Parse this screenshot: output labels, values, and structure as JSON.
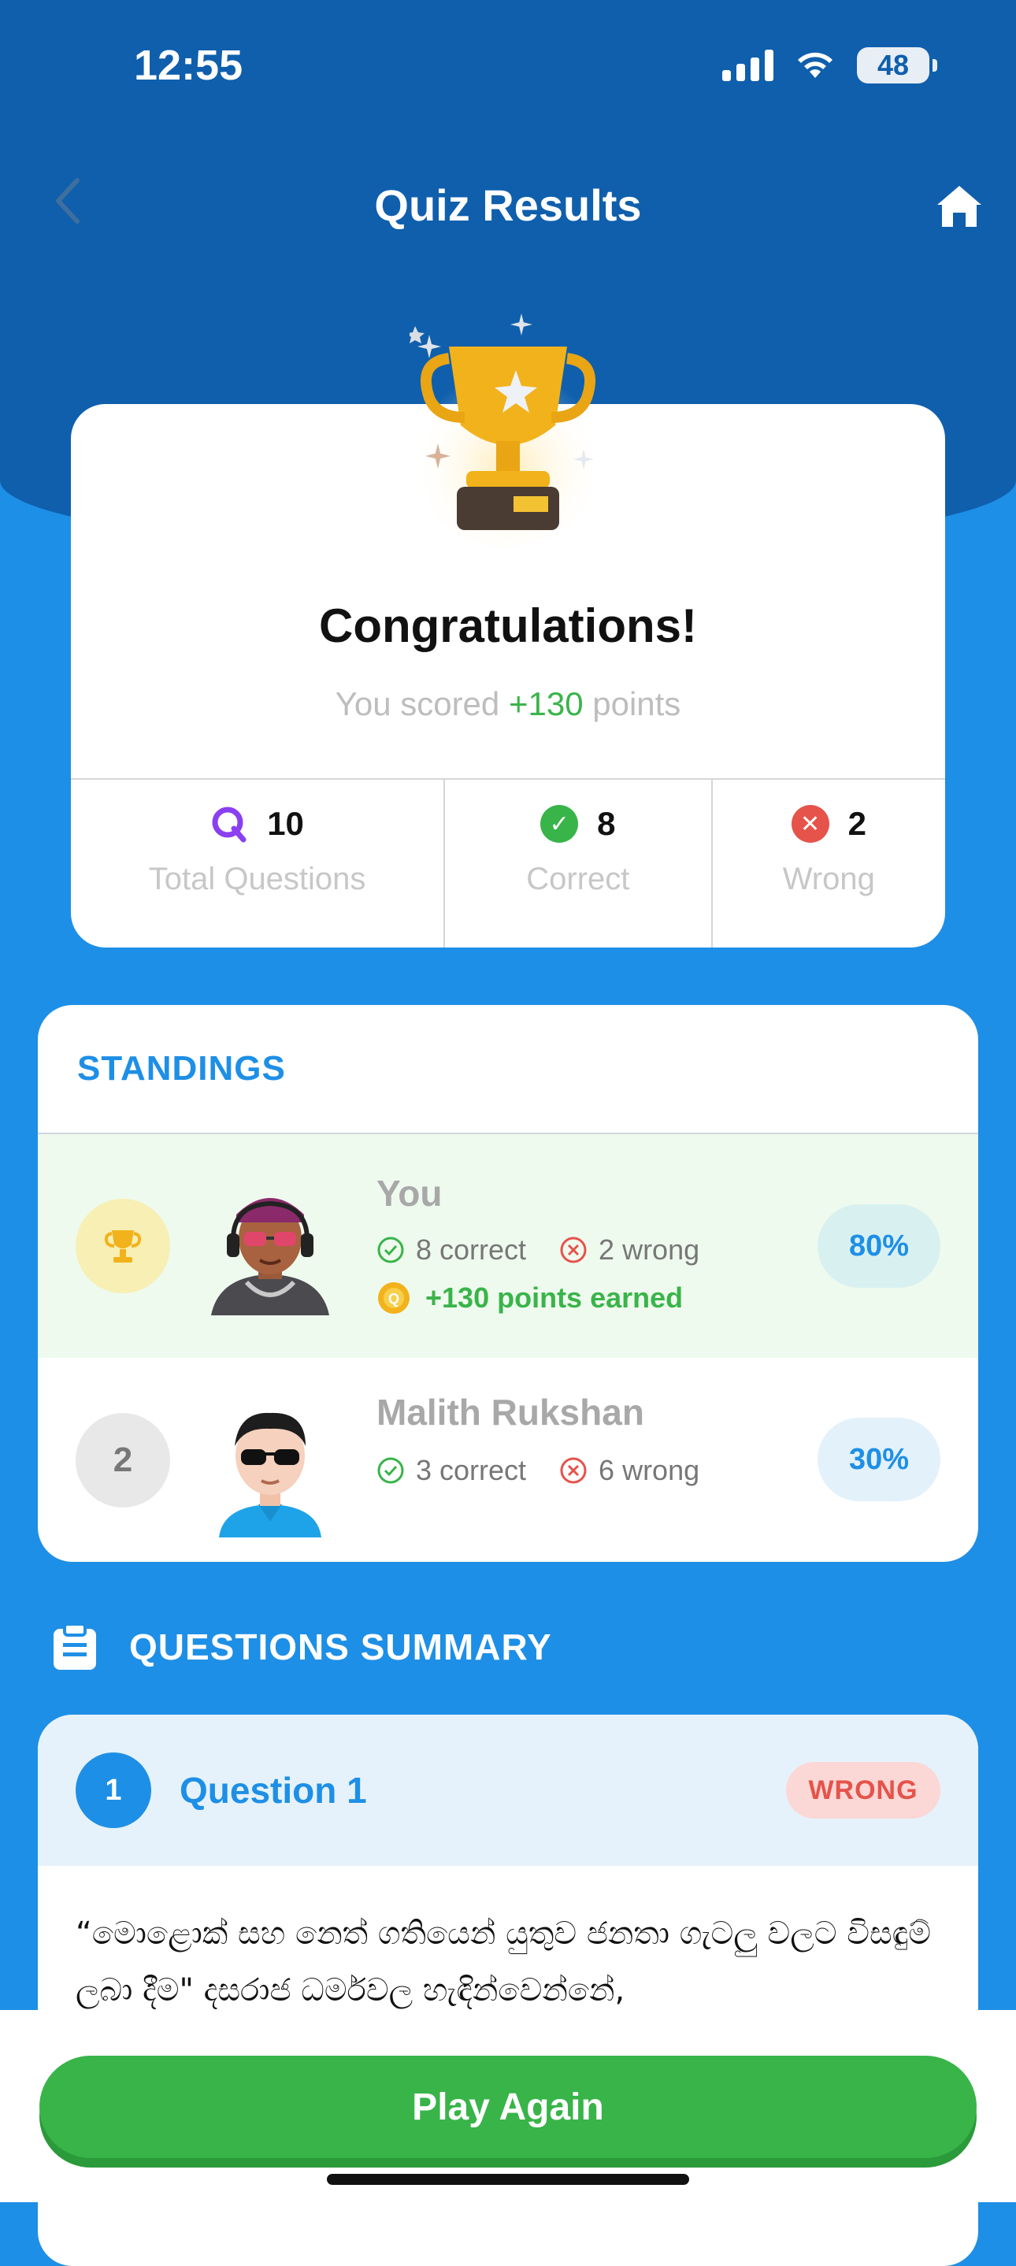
{
  "status": {
    "time": "12:55",
    "battery": "48"
  },
  "nav": {
    "title": "Quiz Results",
    "back_icon": "chevron-left-icon",
    "home_icon": "home-icon"
  },
  "hero": {
    "title": "Congratulations!",
    "score_prefix": "You scored ",
    "score_points": "+130",
    "score_suffix": " points",
    "stats": [
      {
        "value": "10",
        "label": "Total Questions",
        "icon": "quiz-q-icon"
      },
      {
        "value": "8",
        "label": "Correct",
        "icon": "check-circle-icon"
      },
      {
        "value": "2",
        "label": "Wrong",
        "icon": "x-circle-icon"
      }
    ]
  },
  "standings": {
    "title": "STANDINGS",
    "rows": [
      {
        "rank": "",
        "name": "You",
        "correct": "8 correct",
        "wrong": "2 wrong",
        "earned": "+130 points earned",
        "percent": "80%"
      },
      {
        "rank": "2",
        "name": "Malith Rukshan",
        "correct": "3 correct",
        "wrong": "6 wrong",
        "percent": "30%"
      }
    ]
  },
  "summary": {
    "title": "QUESTIONS SUMMARY",
    "question": {
      "number": "1",
      "title": "Question 1",
      "status": "WRONG",
      "text": "“මොළොක් සහ නෙත් ගතියෙන් යුතුව ජනතා ගැටලු වලට විසඳුම් ලබා දීම\" දසරාජ ධර්මවල හැඳින්වෙන්නේ,"
    }
  },
  "actions": {
    "play_again": "Play Again"
  },
  "colors": {
    "primary": "#1e8fe6",
    "header": "#0f5fad",
    "success": "#38b449",
    "danger": "#e5534b"
  }
}
